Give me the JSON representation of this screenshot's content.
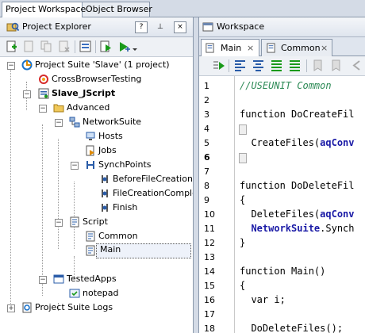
{
  "top_tabs": [
    {
      "label": "Project Workspace",
      "active": true
    },
    {
      "label": "Object Browser",
      "active": false
    }
  ],
  "explorer": {
    "title": "Project Explorer",
    "help_button": "?",
    "pin_button": "⊥",
    "close_button": "×"
  },
  "tree": [
    {
      "label": "Project Suite 'Slave' (1 project)",
      "icon": "project-suite-icon"
    },
    {
      "label": "CrossBrowserTesting",
      "icon": "cross-browser-icon"
    },
    {
      "label": "Slave_JScript",
      "icon": "project-icon"
    },
    {
      "label": "Advanced",
      "icon": "folder-icon"
    },
    {
      "label": "NetworkSuite",
      "icon": "network-suite-icon"
    },
    {
      "label": "Hosts",
      "icon": "hosts-icon"
    },
    {
      "label": "Jobs",
      "icon": "jobs-icon"
    },
    {
      "label": "SynchPoints",
      "icon": "synchpoints-icon"
    },
    {
      "label": "BeforeFileCreation",
      "icon": "synchpoint-icon"
    },
    {
      "label": "FileCreationCompleted",
      "icon": "synchpoint-icon"
    },
    {
      "label": "Finish",
      "icon": "synchpoint-icon"
    },
    {
      "label": "Script",
      "icon": "script-folder-icon"
    },
    {
      "label": "Common",
      "icon": "unit-icon"
    },
    {
      "label": "Main",
      "icon": "unit-icon"
    },
    {
      "label": "TestedApps",
      "icon": "tested-apps-icon"
    },
    {
      "label": "notepad",
      "icon": "app-icon"
    },
    {
      "label": "Project Suite Logs",
      "icon": "logs-icon"
    }
  ],
  "workspace": {
    "title": "Workspace"
  },
  "editor_tabs": [
    {
      "label": "Main",
      "active": true,
      "close": "×"
    },
    {
      "label": "Common",
      "active": false,
      "close": "×"
    }
  ],
  "code_lines": [
    {
      "n": "1",
      "text": "//USEUNIT Common"
    },
    {
      "n": "2",
      "text": ""
    },
    {
      "n": "3",
      "text": "function DoCreateFil"
    },
    {
      "n": "4",
      "text": "{"
    },
    {
      "n": "5",
      "text": "  CreateFiles(aqConv"
    },
    {
      "n": "6",
      "text": "}"
    },
    {
      "n": "7",
      "text": ""
    },
    {
      "n": "8",
      "text": "function DoDeleteFil"
    },
    {
      "n": "9",
      "text": "{"
    },
    {
      "n": "10",
      "text": "  DeleteFiles(aqConv"
    },
    {
      "n": "11",
      "text": "  NetworkSuite.Synch"
    },
    {
      "n": "12",
      "text": "}"
    },
    {
      "n": "13",
      "text": ""
    },
    {
      "n": "14",
      "text": "function Main()"
    },
    {
      "n": "15",
      "text": "{"
    },
    {
      "n": "16",
      "text": "  var i;"
    },
    {
      "n": "17",
      "text": ""
    },
    {
      "n": "18",
      "text": "  DoDeleteFiles();"
    }
  ],
  "code_tokens": {
    "l5_pre": "  CreateFiles(",
    "l5_obj": "aqConv",
    "l10_pre": "  DeleteFiles(",
    "l10_obj": "aqConv",
    "l11_obj": "NetworkSuite",
    "l11_post": ".Synch"
  }
}
